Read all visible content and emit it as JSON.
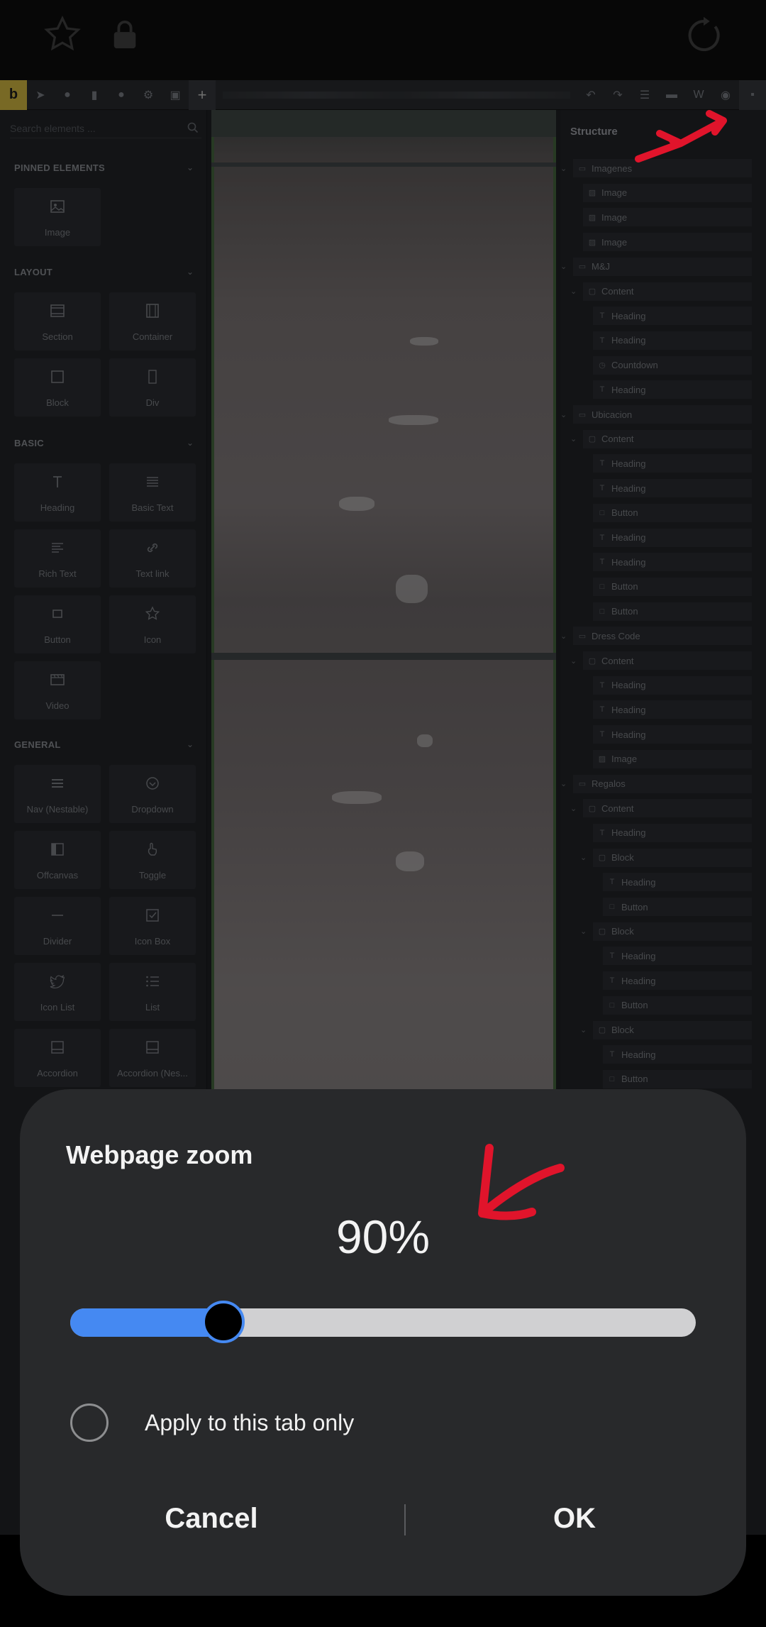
{
  "browser": {
    "star_icon": "star-outline-icon",
    "lock_icon": "lock-icon",
    "reload_icon": "reload-icon"
  },
  "editor": {
    "logo": "b",
    "search_placeholder": "Search elements ...",
    "categories": {
      "pinned": "PINNED ELEMENTS",
      "layout": "LAYOUT",
      "basic": "BASIC",
      "general": "GENERAL"
    },
    "pinned_elements": [
      {
        "label": "Image",
        "icon": "image-icon"
      }
    ],
    "layout_elements": [
      {
        "label": "Section",
        "icon": "section-icon"
      },
      {
        "label": "Container",
        "icon": "container-icon"
      },
      {
        "label": "Block",
        "icon": "block-icon"
      },
      {
        "label": "Div",
        "icon": "div-icon"
      }
    ],
    "basic_elements": [
      {
        "label": "Heading",
        "icon": "heading-icon"
      },
      {
        "label": "Basic Text",
        "icon": "basic-text-icon"
      },
      {
        "label": "Rich Text",
        "icon": "rich-text-icon"
      },
      {
        "label": "Text link",
        "icon": "link-icon"
      },
      {
        "label": "Button",
        "icon": "button-icon"
      },
      {
        "label": "Icon",
        "icon": "star-icon"
      },
      {
        "label": "Video",
        "icon": "video-icon"
      }
    ],
    "general_elements": [
      {
        "label": "Nav (Nestable)",
        "icon": "nav-icon"
      },
      {
        "label": "Dropdown",
        "icon": "dropdown-icon"
      },
      {
        "label": "Offcanvas",
        "icon": "offcanvas-icon"
      },
      {
        "label": "Toggle",
        "icon": "toggle-icon"
      },
      {
        "label": "Divider",
        "icon": "divider-icon"
      },
      {
        "label": "Icon Box",
        "icon": "icon-box-icon"
      },
      {
        "label": "Icon List",
        "icon": "twitter-icon"
      },
      {
        "label": "List",
        "icon": "list-icon"
      },
      {
        "label": "Accordion",
        "icon": "accordion-icon"
      },
      {
        "label": "Accordion (Nes...",
        "icon": "accordion-nested-icon"
      }
    ],
    "structure": {
      "title": "Structure",
      "items": [
        {
          "label": "Imagenes",
          "depth": 0,
          "icon": "section"
        },
        {
          "label": "Image",
          "depth": 1,
          "icon": "image"
        },
        {
          "label": "Image",
          "depth": 1,
          "icon": "image"
        },
        {
          "label": "Image",
          "depth": 1,
          "icon": "image"
        },
        {
          "label": "M&J",
          "depth": 0,
          "icon": "section"
        },
        {
          "label": "Content",
          "depth": 1,
          "icon": "container"
        },
        {
          "label": "Heading",
          "depth": 2,
          "icon": "heading"
        },
        {
          "label": "Heading",
          "depth": 2,
          "icon": "heading"
        },
        {
          "label": "Countdown",
          "depth": 2,
          "icon": "countdown"
        },
        {
          "label": "Heading",
          "depth": 2,
          "icon": "heading"
        },
        {
          "label": "Ubicacion",
          "depth": 0,
          "icon": "section"
        },
        {
          "label": "Content",
          "depth": 1,
          "icon": "container"
        },
        {
          "label": "Heading",
          "depth": 2,
          "icon": "heading"
        },
        {
          "label": "Heading",
          "depth": 2,
          "icon": "heading"
        },
        {
          "label": "Button",
          "depth": 2,
          "icon": "button"
        },
        {
          "label": "Heading",
          "depth": 2,
          "icon": "heading"
        },
        {
          "label": "Heading",
          "depth": 2,
          "icon": "heading"
        },
        {
          "label": "Button",
          "depth": 2,
          "icon": "button"
        },
        {
          "label": "Button",
          "depth": 2,
          "icon": "button"
        },
        {
          "label": "Dress Code",
          "depth": 0,
          "icon": "section"
        },
        {
          "label": "Content",
          "depth": 1,
          "icon": "container"
        },
        {
          "label": "Heading",
          "depth": 2,
          "icon": "heading"
        },
        {
          "label": "Heading",
          "depth": 2,
          "icon": "heading"
        },
        {
          "label": "Heading",
          "depth": 2,
          "icon": "heading"
        },
        {
          "label": "Image",
          "depth": 2,
          "icon": "image"
        },
        {
          "label": "Regalos",
          "depth": 0,
          "icon": "section"
        },
        {
          "label": "Content",
          "depth": 1,
          "icon": "container"
        },
        {
          "label": "Heading",
          "depth": 2,
          "icon": "heading"
        },
        {
          "label": "Block",
          "depth": 2,
          "icon": "block"
        },
        {
          "label": "Heading",
          "depth": 3,
          "icon": "heading"
        },
        {
          "label": "Button",
          "depth": 3,
          "icon": "button"
        },
        {
          "label": "Block",
          "depth": 2,
          "icon": "block"
        },
        {
          "label": "Heading",
          "depth": 3,
          "icon": "heading"
        },
        {
          "label": "Heading",
          "depth": 3,
          "icon": "heading"
        },
        {
          "label": "Button",
          "depth": 3,
          "icon": "button"
        },
        {
          "label": "Block",
          "depth": 2,
          "icon": "block"
        },
        {
          "label": "Heading",
          "depth": 3,
          "icon": "heading"
        },
        {
          "label": "Button",
          "depth": 3,
          "icon": "button"
        }
      ]
    }
  },
  "zoom_dialog": {
    "title": "Webpage zoom",
    "value_text": "90%",
    "zoom_fraction": 0.245,
    "apply_label": "Apply to this tab only",
    "cancel_label": "Cancel",
    "ok_label": "OK",
    "accent_color": "#4589f2"
  },
  "annotation_color": "#e0142b"
}
